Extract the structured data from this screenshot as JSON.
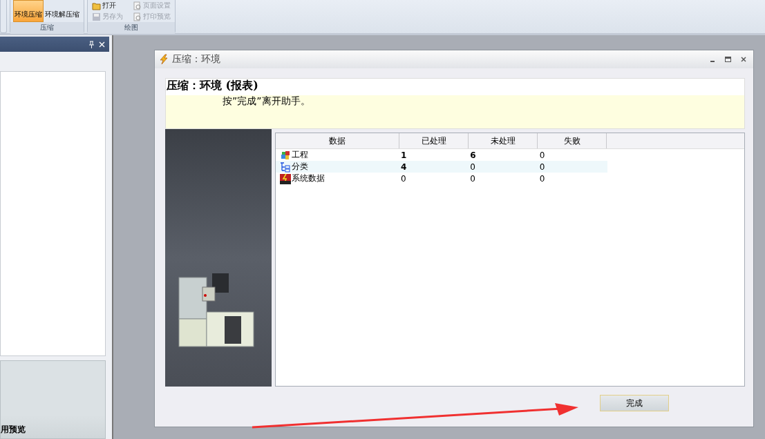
{
  "ribbon": {
    "groups": [
      {
        "label": "压缩",
        "buttons": [
          {
            "label": "环境压缩",
            "selected": true
          },
          {
            "label": "环境解压缩",
            "selected": false
          }
        ]
      },
      {
        "label": "绘图",
        "items": [
          {
            "label": "打开",
            "disabled": false
          },
          {
            "label": "页面设置",
            "disabled": true
          },
          {
            "label": "另存为",
            "disabled": true
          },
          {
            "label": "打印预览",
            "disabled": true
          }
        ]
      }
    ]
  },
  "side_panel": {
    "footer_text": "用预览"
  },
  "dialog": {
    "title": "压缩：环境",
    "heading": "压缩：环境 (报表)",
    "instruction": "按”完成”离开助手。",
    "table": {
      "columns": [
        "数据",
        "已处理",
        "未处理",
        "失败"
      ],
      "rows": [
        {
          "kind": "project",
          "cells": [
            {
              "text": "工程",
              "bold": false
            },
            {
              "text": "1",
              "bold": true
            },
            {
              "text": "6",
              "bold": true
            },
            {
              "text": "0",
              "bold": false
            }
          ],
          "selected": false
        },
        {
          "kind": "category",
          "cells": [
            {
              "text": "分类",
              "bold": false
            },
            {
              "text": "4",
              "bold": true
            },
            {
              "text": "0",
              "bold": false
            },
            {
              "text": "0",
              "bold": false
            }
          ],
          "selected": true
        },
        {
          "kind": "system",
          "cells": [
            {
              "text": "系统数据",
              "bold": false
            },
            {
              "text": "0",
              "bold": false
            },
            {
              "text": "0",
              "bold": false
            },
            {
              "text": "0",
              "bold": false
            }
          ],
          "selected": false
        }
      ]
    },
    "finish_button": "完成"
  }
}
